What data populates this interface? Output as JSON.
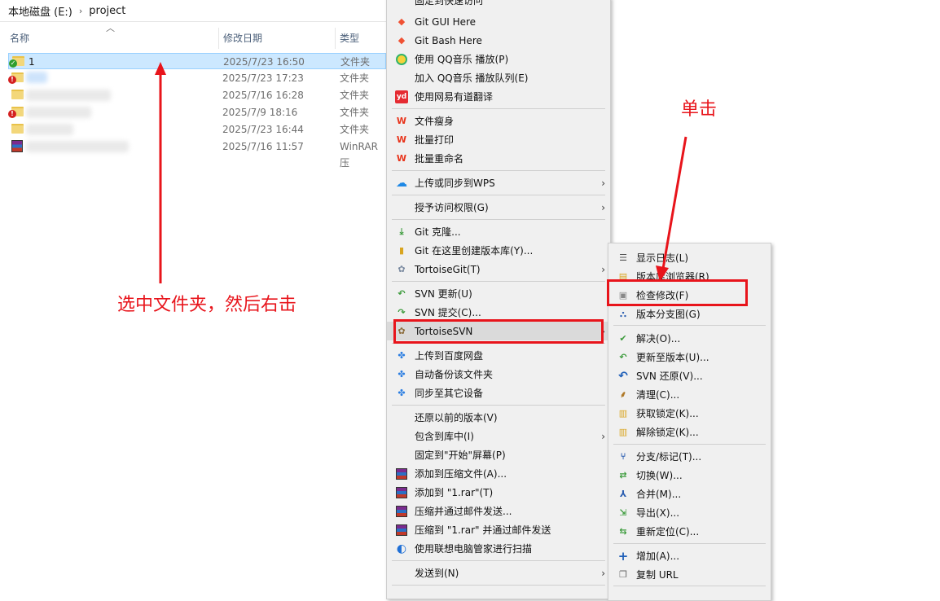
{
  "breadcrumb": {
    "drive": "本地磁盘 (E:)",
    "separator": "›",
    "folder": "project"
  },
  "columns": {
    "name": "名称",
    "date": "修改日期",
    "type": "类型"
  },
  "files": [
    {
      "name": "1",
      "date": "2025/7/23 16:50",
      "type": "文件夹",
      "status": "ok"
    },
    {
      "name": "",
      "date": "2025/7/23 17:23",
      "type": "文件夹",
      "status": "err"
    },
    {
      "name": "",
      "date": "2025/7/16 16:28",
      "type": "文件夹",
      "status": "none"
    },
    {
      "name": "",
      "date": "2025/7/9 18:16",
      "type": "文件夹",
      "status": "err"
    },
    {
      "name": "",
      "date": "2025/7/23 16:44",
      "type": "文件夹",
      "status": "none"
    },
    {
      "name": "",
      "date": "2025/7/16 11:57",
      "type": "WinRAR 压",
      "status": "rar"
    }
  ],
  "menu": {
    "top_cut": "固定到快速访问",
    "items": [
      "Git GUI Here",
      "Git Bash Here",
      "使用 QQ音乐 播放(P)",
      "加入 QQ音乐 播放队列(E)",
      "使用网易有道翻译",
      "文件瘦身",
      "批量打印",
      "批量重命名",
      "上传或同步到WPS",
      "授予访问权限(G)",
      "Git 克隆...",
      "Git 在这里创建版本库(Y)...",
      "TortoiseGit(T)",
      "SVN 更新(U)",
      "SVN 提交(C)...",
      "TortoiseSVN",
      "上传到百度网盘",
      "自动备份该文件夹",
      "同步至其它设备",
      "还原以前的版本(V)",
      "包含到库中(I)",
      "固定到\"开始\"屏幕(P)",
      "添加到压缩文件(A)...",
      "添加到 \"1.rar\"(T)",
      "压缩并通过邮件发送...",
      "压缩到 \"1.rar\" 并通过邮件发送",
      "使用联想电脑管家进行扫描",
      "发送到(N)"
    ]
  },
  "submenu": {
    "items": [
      "显示日志(L)",
      "版本库浏览器(R)",
      "检查修改(F)",
      "版本分支图(G)",
      "解决(O)...",
      "更新至版本(U)...",
      "SVN 还原(V)...",
      "清理(C)...",
      "获取锁定(K)...",
      "解除锁定(K)...",
      "分支/标记(T)...",
      "切换(W)...",
      "合并(M)...",
      "导出(X)...",
      "重新定位(C)...",
      "增加(A)...",
      "复制 URL"
    ]
  },
  "annotations": {
    "left_note": "选中文件夹，然后右击",
    "right_note": "单击"
  },
  "colors": {
    "accent_red": "#e8141b",
    "selection": "#cce8ff"
  }
}
